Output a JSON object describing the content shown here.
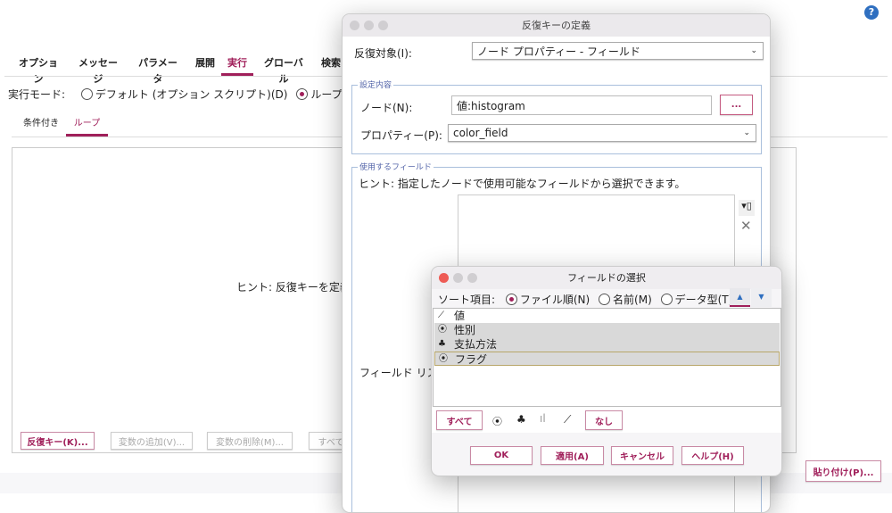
{
  "help_icon": "question-circle-icon",
  "main": {
    "tabs": [
      "オプション",
      "メッセージ",
      "パラメータ",
      "展開",
      "実行",
      "グローバル",
      "検索"
    ],
    "active_tab": "実行",
    "run_mode_label": "実行モード:",
    "run_modes": [
      {
        "label": "デフォルト (オプション スクリプト)(D)",
        "selected": false
      },
      {
        "label": "ループ /",
        "selected": true
      }
    ],
    "subtabs": [
      "条件付き",
      "ループ"
    ],
    "active_subtab": "ループ",
    "hint": "ヒント: 反復キーを定義",
    "buttons": {
      "iter_key": "反復キー(K)...",
      "add_var": "変数の追加(V)...",
      "del_var": "変数の削除(M)...",
      "all": "すべて"
    },
    "paste": "貼り付け(P)..."
  },
  "iter_dialog": {
    "title": "反復キーの定義",
    "target_label": "反復対象(I):",
    "target_value": "ノード プロパティー - フィールド",
    "settings_group": "設定内容",
    "node_label": "ノード(N):",
    "node_value": "値:histogram",
    "browse": "...",
    "property_label": "プロパティー(P):",
    "property_value": "color_field",
    "fields_group": "使用するフィールド",
    "fields_hint": "ヒント: 指定したノードで使用可能なフィールドから選択できます。",
    "field_list_label": "フィールド リス"
  },
  "field_dialog": {
    "title": "フィールドの選択",
    "sort_label": "ソート項目:",
    "sort_options": [
      {
        "label": "ファイル順(N)",
        "selected": true
      },
      {
        "label": "名前(M)",
        "selected": false
      },
      {
        "label": "データ型(T)",
        "selected": false
      }
    ],
    "fields": [
      {
        "name": "値",
        "icon": "continuous-icon",
        "selected": false
      },
      {
        "name": "性別",
        "icon": "flag-icon",
        "selected": true
      },
      {
        "name": "支払方法",
        "icon": "nominal-icon",
        "selected": true
      },
      {
        "name": "フラグ",
        "icon": "flag-icon",
        "selected": true
      }
    ],
    "all": "すべて",
    "none": "なし",
    "ok": "OK",
    "apply": "適用(A)",
    "cancel": "キャンセル",
    "help": "ヘルプ(H)"
  },
  "colors": {
    "accent": "#a01f5a",
    "selection": "#d9d9d9"
  }
}
